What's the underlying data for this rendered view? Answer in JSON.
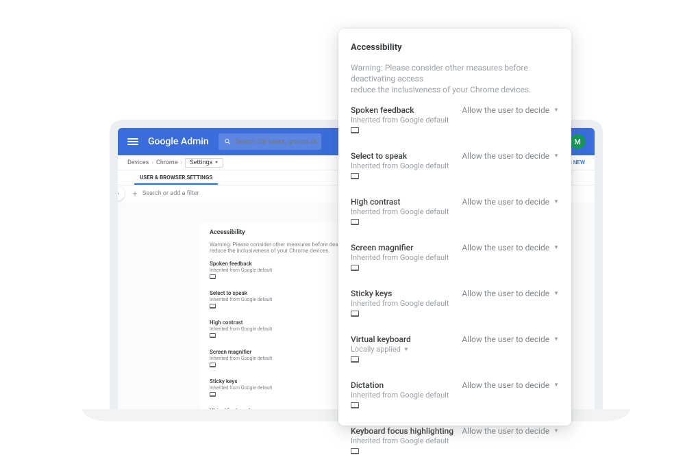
{
  "header": {
    "title": "Google Admin",
    "search_placeholder": "Search for users, groups or settings",
    "avatar_initial": "M"
  },
  "breadcrumb": {
    "items": [
      "Devices",
      "Chrome",
      "Settings"
    ],
    "whats_new": "'S NEW"
  },
  "tabs": {
    "active": "USER & BROWSER SETTINGS"
  },
  "filter": {
    "placeholder": "Search or add a filter"
  },
  "panel": {
    "title": "Accessibility",
    "warning_a": "Warning: Please consider other measures before deactivating access",
    "warning_b": "reduce the inclusiveness of your Chrome devices.",
    "warning_bg_a": "Warning: Please consider other measures before deact",
    "warning_bg_b": "reduce the inclusiveness of your Chrome devices.",
    "inherited_label": "Inherited from Google default",
    "local_label": "Locally applied",
    "decide_value": "Allow the user to decide",
    "decide_value_bg": "Allow the user to decid",
    "settings": [
      {
        "name": "Spoken feedback",
        "source": "inherited"
      },
      {
        "name": "Select to speak",
        "source": "inherited"
      },
      {
        "name": "High contrast",
        "source": "inherited"
      },
      {
        "name": "Screen magnifier",
        "source": "inherited"
      },
      {
        "name": "Sticky keys",
        "source": "inherited"
      },
      {
        "name": "Virtual keyboard",
        "source": "local"
      },
      {
        "name": "Dictation",
        "source": "inherited"
      },
      {
        "name": "Keyboard focus highlighting",
        "source": "inherited"
      }
    ]
  }
}
